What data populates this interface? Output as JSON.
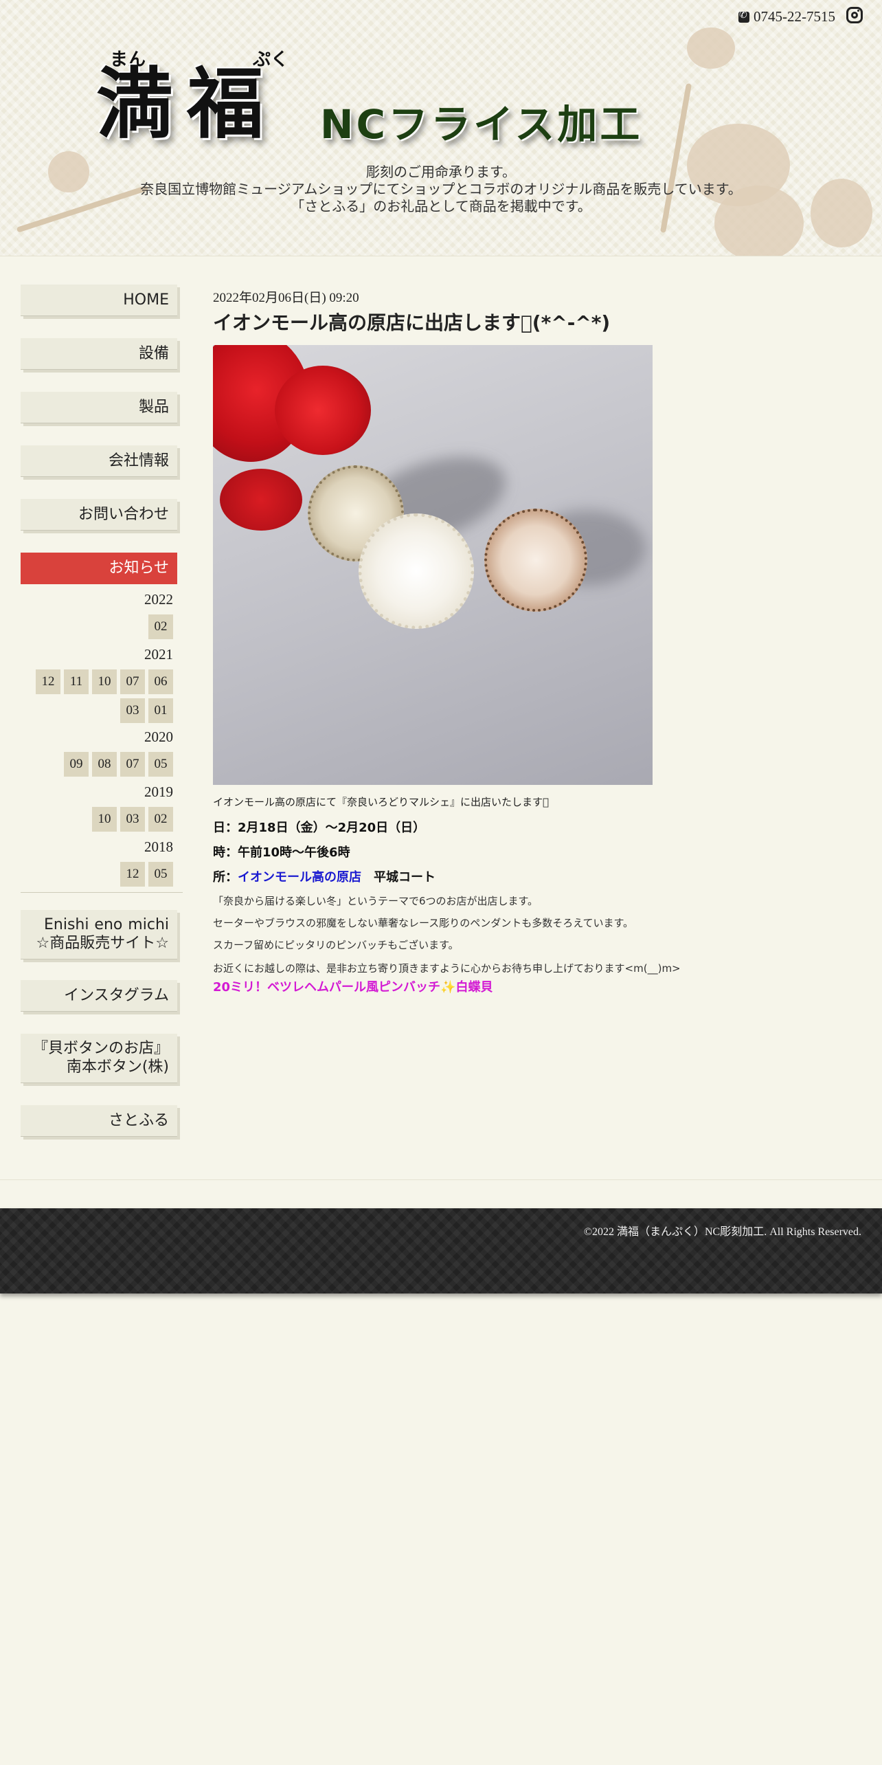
{
  "header": {
    "phone": "0745-22-7515",
    "phone_icon": "phone-icon",
    "instagram_icon": "instagram-icon",
    "logo_ruby": [
      "まん",
      "ぷく"
    ],
    "logo_main": "満福",
    "logo_sub": "NCフライス加工",
    "tagline": [
      "彫刻のご用命承ります。",
      "奈良国立博物館ミュージアムショップにてショップとコラボのオリジナル商品を販売しています。",
      "「さとふる」のお礼品として商品を掲載中です。"
    ]
  },
  "sidebar": {
    "nav": [
      {
        "label": "HOME"
      },
      {
        "label": "設備"
      },
      {
        "label": "製品"
      },
      {
        "label": "会社情報"
      },
      {
        "label": "お問い合わせ"
      },
      {
        "label": "お知らせ",
        "active": true
      }
    ],
    "archive": [
      {
        "year": "2022",
        "months": [
          "02"
        ]
      },
      {
        "year": "2021",
        "months": [
          "12",
          "11",
          "10",
          "07",
          "06",
          "03",
          "01"
        ]
      },
      {
        "year": "2020",
        "months": [
          "09",
          "08",
          "07",
          "05"
        ]
      },
      {
        "year": "2019",
        "months": [
          "10",
          "03",
          "02"
        ]
      },
      {
        "year": "2018",
        "months": [
          "12",
          "05"
        ]
      }
    ],
    "links": [
      {
        "line1": "Enishi eno michi",
        "line2": "☆商品販売サイト☆"
      },
      {
        "line1": "インスタグラム"
      },
      {
        "line1": "『貝ボタンのお店』",
        "line2": "南本ボタン(株)"
      },
      {
        "line1": "さとふる"
      }
    ]
  },
  "post": {
    "date": "2022年02月06日(日)  09:20",
    "title": "イオンモール高の原店に出店します\u0000(*^-^*)",
    "caption": "イオンモール高の原店にて『奈良いろどりマルシェ』に出店いたします\u0000",
    "day_label": "日：",
    "day_value": "2月18日（金）～2月20日（日）",
    "time_label": "時：",
    "time_value": "午前10時～午後6時",
    "place_label": "所：",
    "place_link": "イオンモール高の原店",
    "place_rest": "　平城コート",
    "body": [
      "「奈良から届ける楽しい冬」というテーマで6つのお店が出店します。",
      "セーターやブラウスの邪魔をしない華奢なレース彫りのペンダントも多数そろえています。",
      "スカーフ留めにピッタリのピンバッチもございます。",
      "お近くにお越しの際は、是非お立ち寄り頂きますように心からお待ち申し上げております<m(__)m>"
    ],
    "promo": "20ミリ！ベツレヘムパール風ピンバッチ✨白蝶貝"
  },
  "footer": {
    "copyright": "©2022 満福（まんぷく）NC彫刻加工. All Rights Reserved."
  },
  "colors": {
    "background": "#f6f5ea",
    "accent": "#d9423c",
    "link": "#1a1ad0",
    "promo": "#d31ad3",
    "footer": "#222222"
  }
}
